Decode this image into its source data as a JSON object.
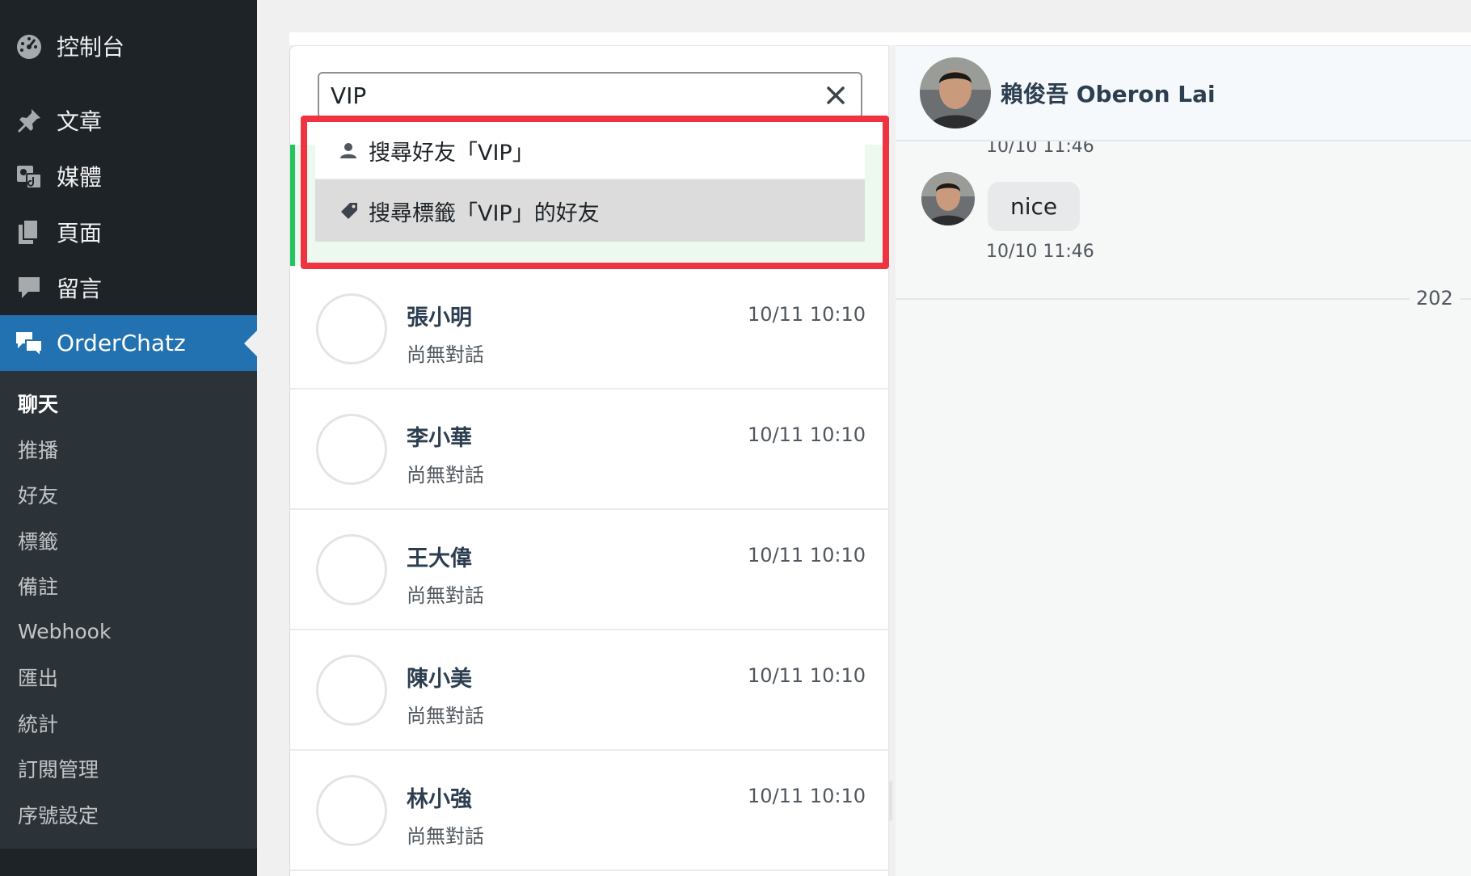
{
  "sidebar": {
    "dashboard": "控制台",
    "posts": "文章",
    "media": "媒體",
    "pages": "頁面",
    "comments": "留言",
    "plugin": "OrderChatz",
    "submenu": [
      "聊天",
      "推播",
      "好友",
      "標籤",
      "備註",
      "Webhook",
      "匯出",
      "統計",
      "訂閱管理",
      "序號設定"
    ]
  },
  "search": {
    "value": "VIP"
  },
  "dropdown": {
    "search_friends": "搜尋好友「VIP」",
    "search_tags": "搜尋標籤「VIP」的好友"
  },
  "friends": [
    {
      "name": "張小明",
      "time": "10/11 10:10",
      "preview": "尚無對話"
    },
    {
      "name": "李小華",
      "time": "10/11 10:10",
      "preview": "尚無對話"
    },
    {
      "name": "王大偉",
      "time": "10/11 10:10",
      "preview": "尚無對話"
    },
    {
      "name": "陳小美",
      "time": "10/11 10:10",
      "preview": "尚無對話"
    },
    {
      "name": "林小強",
      "time": "10/11 10:10",
      "preview": "尚無對話"
    }
  ],
  "chat": {
    "contact_name": "賴俊吾 Oberon Lai",
    "prev_time": "10/10 11:46",
    "message": "nice",
    "message_time": "10/10 11:46",
    "date_divider": "202"
  },
  "colors": {
    "sidebar_bg": "#1d2327",
    "active_menu": "#2271b1",
    "highlight_border": "#ef3340",
    "active_friend_accent": "#22c55e"
  }
}
